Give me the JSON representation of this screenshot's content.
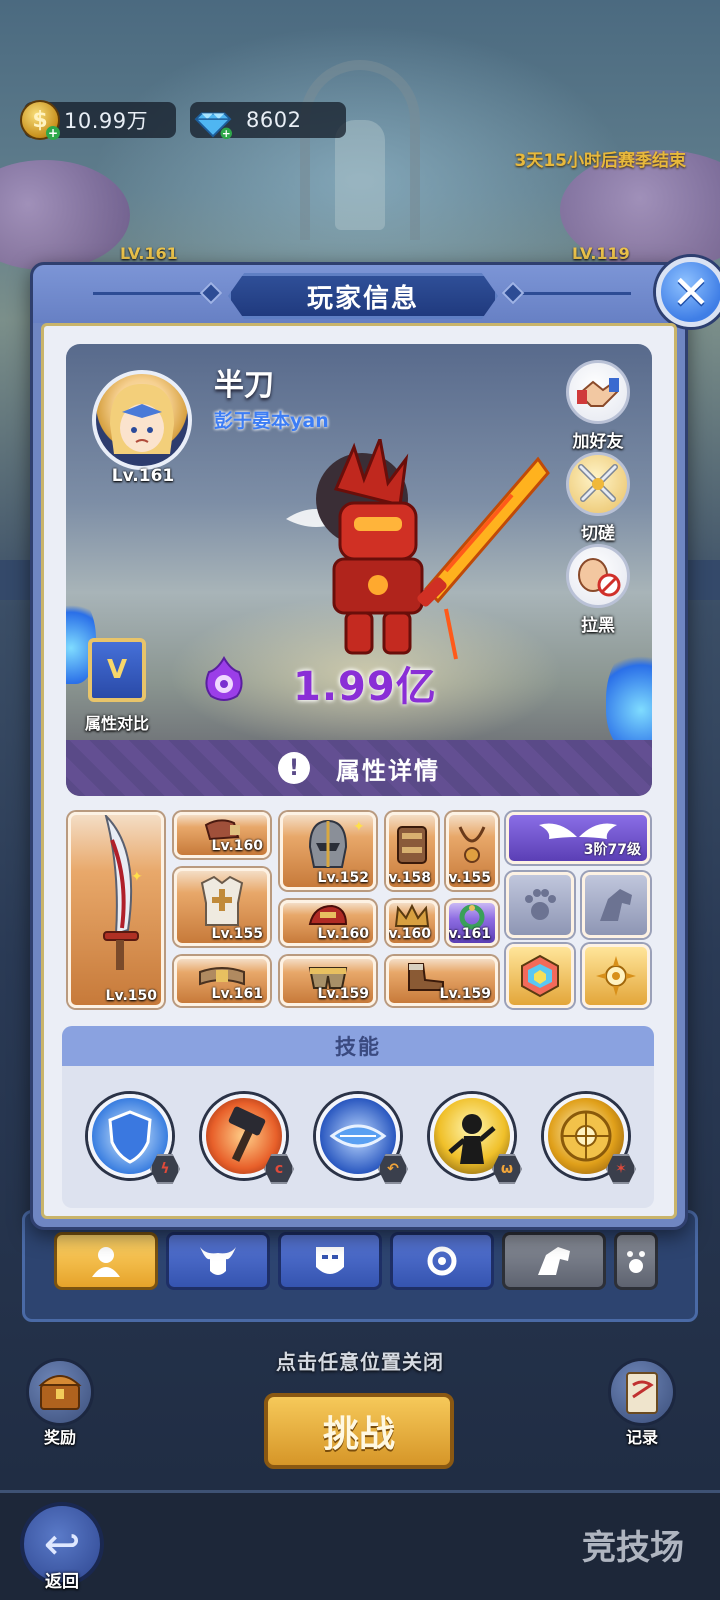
{
  "currency": {
    "gold": {
      "icon": "gold-coin-icon",
      "value": "10.99万"
    },
    "diamond": {
      "icon": "diamond-icon",
      "value": "8602"
    }
  },
  "season": {
    "countdown": "3天15小时后赛季结束"
  },
  "background_levels": {
    "left": "LV.161",
    "right": "LV.119"
  },
  "dialog": {
    "title": "玩家信息",
    "player": {
      "name": "半刀",
      "guild": "彭于晏本yan",
      "level": "Lv.161",
      "power": "1.99亿"
    },
    "actions": {
      "add_friend": "加好友",
      "spar": "切磋",
      "block": "拉黑",
      "compare": "属性对比"
    },
    "detail_label": "属性详情",
    "equipment": {
      "weapon_level": "Lv.150",
      "gloves_level": "Lv.160",
      "armor_level": "Lv.155",
      "belt_level": "Lv.161",
      "helmet_level": "Lv.152",
      "shoulder_level": "Lv.160",
      "pants_level": "Lv.159",
      "bracer_level": "Lv.158",
      "necklace_level": "Lv.155",
      "ring_level": "Lv.160",
      "wreath_level": "Lv.161",
      "boots_level": "Lv.159",
      "wings_level": "3阶77级"
    },
    "skills_title": "技能",
    "skills": [
      {
        "icon": "shield-skill-icon",
        "badge_color": "#e04a3a"
      },
      {
        "icon": "hammer-skill-icon",
        "badge_color": "#e04a3a"
      },
      {
        "icon": "blue-gem-skill-icon",
        "badge_color": "#f0a43a"
      },
      {
        "icon": "shadow-figure-skill-icon",
        "badge_color": "#f0a43a"
      },
      {
        "icon": "golden-shield-skill-icon",
        "badge_color": "#e04a3a"
      }
    ]
  },
  "close_hint": "点击任意位置关闭",
  "challenge_label": "挑战",
  "side_buttons": {
    "reward": "奖励",
    "record": "记录"
  },
  "bottom": {
    "back_label": "返回",
    "arena_title": "竞技场"
  }
}
